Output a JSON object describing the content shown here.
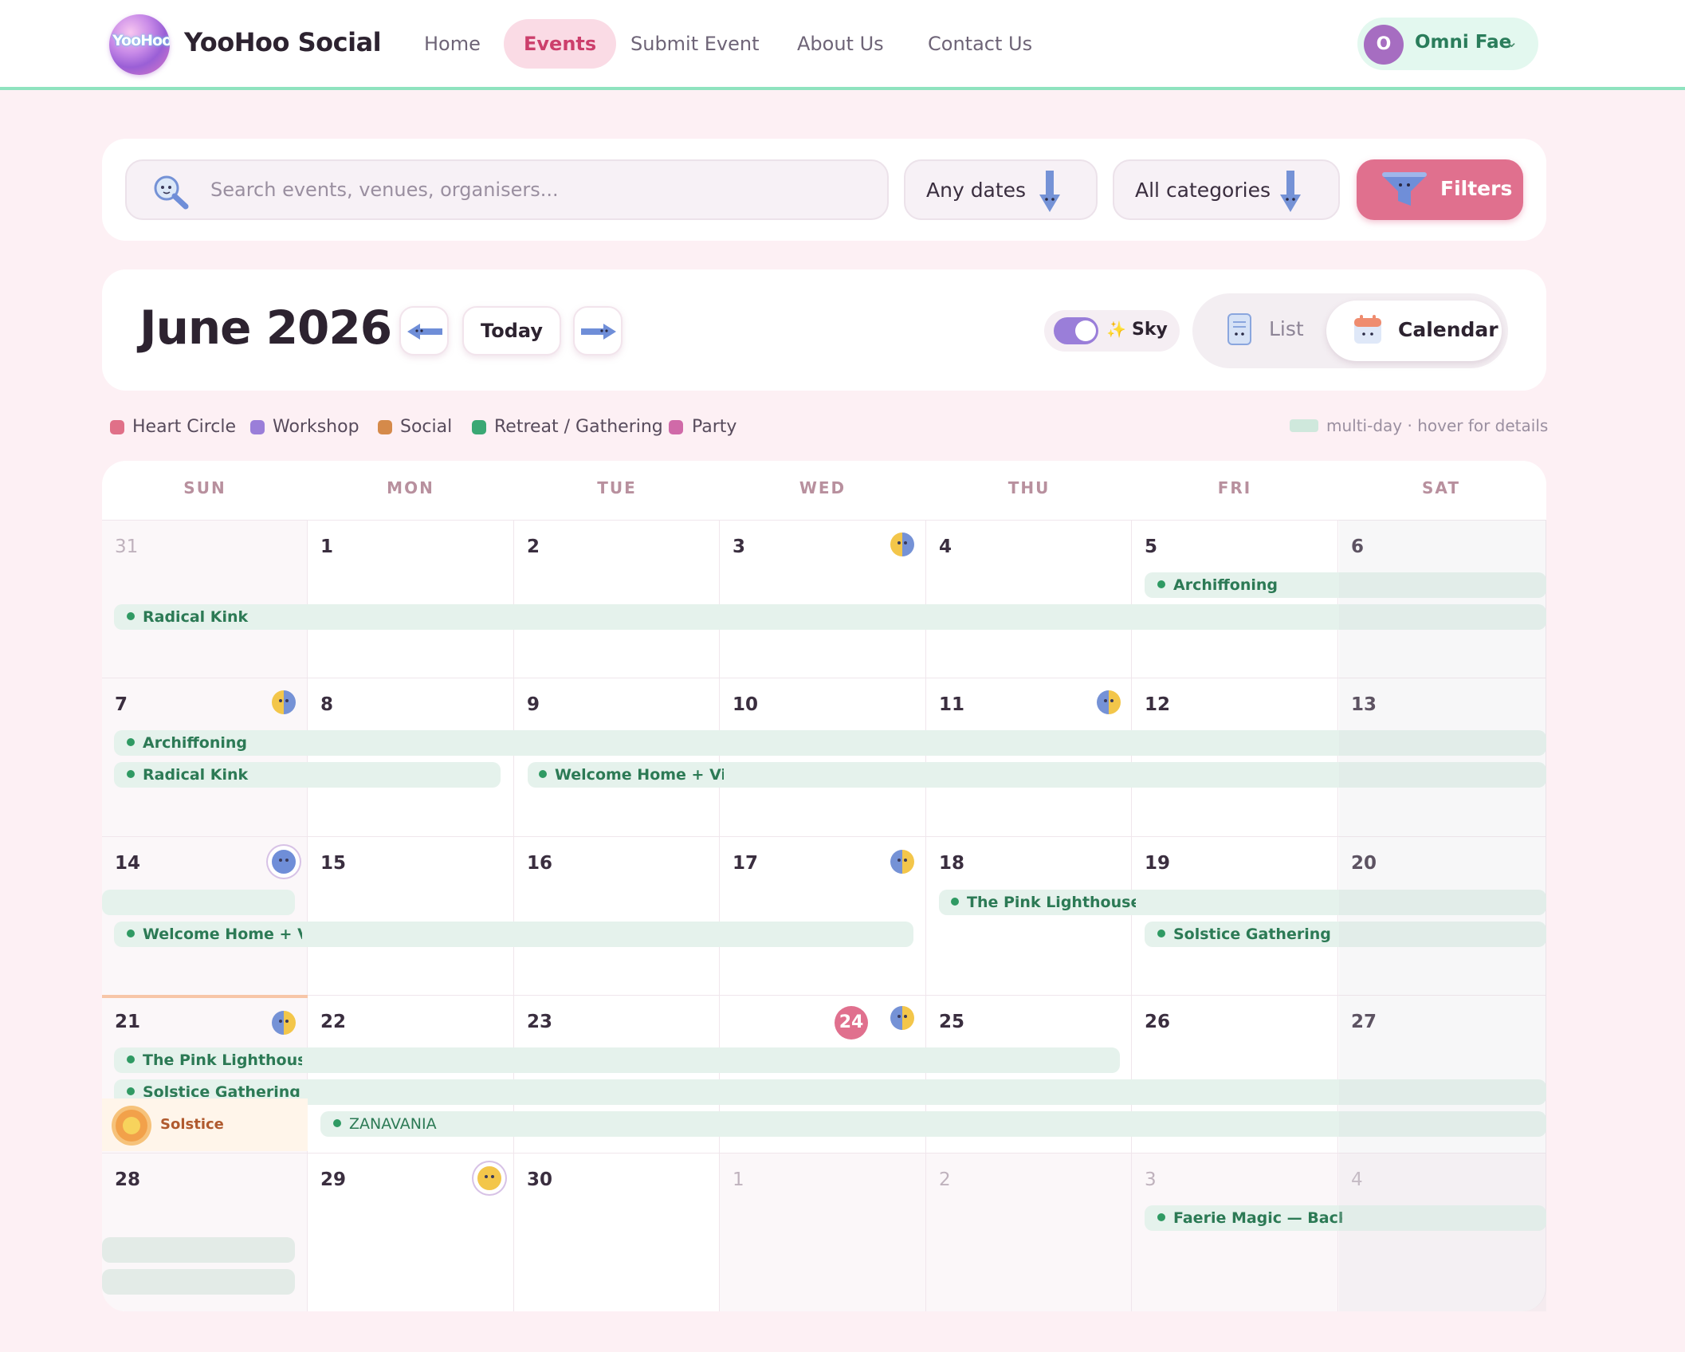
{
  "brand": {
    "name": "YooHoo Social",
    "logo_text": "YooHoo"
  },
  "nav": {
    "items": [
      "Home",
      "Events",
      "Submit Event",
      "About Us",
      "Contact Us"
    ],
    "active": "Events"
  },
  "user": {
    "initial": "O",
    "name": "Omni Fae"
  },
  "search": {
    "placeholder": "Search events, venues, organisers...",
    "dates": "Any dates",
    "categories": "All categories",
    "filters": "Filters"
  },
  "calendar_header": {
    "month": "June 2026",
    "today": "Today",
    "sky_label": "Sky",
    "sky_sparkle": "✨",
    "view_list": "List",
    "view_calendar": "Calendar",
    "active_view": "Calendar",
    "sky_on": true
  },
  "legend": {
    "items": [
      {
        "label": "Heart Circle",
        "color": "#e07088"
      },
      {
        "label": "Workshop",
        "color": "#9a7ed9"
      },
      {
        "label": "Social",
        "color": "#d58a4a"
      },
      {
        "label": "Retreat / Gathering",
        "color": "#3aa874"
      },
      {
        "label": "Party",
        "color": "#d06aa8"
      }
    ],
    "note": "multi-day · hover for details"
  },
  "weekdays": [
    "SUN",
    "MON",
    "TUE",
    "WED",
    "THU",
    "FRI",
    "SAT"
  ],
  "weeks": [
    [
      "31",
      "1",
      "2",
      "3",
      "4",
      "5",
      "6"
    ],
    [
      "7",
      "8",
      "9",
      "10",
      "11",
      "12",
      "13"
    ],
    [
      "14",
      "15",
      "16",
      "17",
      "18",
      "19",
      "20"
    ],
    [
      "21",
      "22",
      "23",
      "24",
      "25",
      "26",
      "27"
    ],
    [
      "28",
      "29",
      "30",
      "1",
      "2",
      "3",
      "4"
    ]
  ],
  "today_date": "24",
  "events": {
    "w1": [
      "Archiffoning",
      "Radical Kink"
    ],
    "w2": [
      "Archiffoning",
      "Radical Kink",
      "Welcome Home + Vi..."
    ],
    "w3": [
      "Welcome Home + Vi...",
      "The Pink Lighthouse...",
      "Solstice Gathering"
    ],
    "w4": [
      "The Pink Lighthouse...",
      "Solstice Gathering",
      "ZANAVANIA"
    ],
    "w5": [
      "Faerie Magic — Back..."
    ]
  },
  "special_day": {
    "label": "Solstice",
    "icon": "sun-icon"
  }
}
